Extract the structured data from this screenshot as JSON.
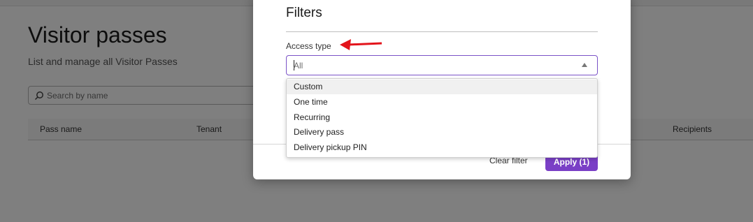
{
  "page": {
    "title": "Visitor passes",
    "subtitle": "List and manage all Visitor Passes",
    "search_placeholder": "Search by name",
    "table_headers": [
      "Pass name",
      "Tenant",
      "Recipients"
    ]
  },
  "modal": {
    "title": "Filters",
    "field_label": "Access type",
    "select_value": "All",
    "options": [
      "Custom",
      "One time",
      "Recurring",
      "Delivery pass",
      "Delivery pickup PIN"
    ],
    "clear_label": "Clear filter",
    "apply_label": "Apply (1)"
  },
  "colors": {
    "accent": "#7a3fc6",
    "annotation_arrow": "#e3141b"
  },
  "icons": {
    "search": "search-icon",
    "select_caret": "triangle-up-icon",
    "annotation": "red-arrow-icon"
  }
}
